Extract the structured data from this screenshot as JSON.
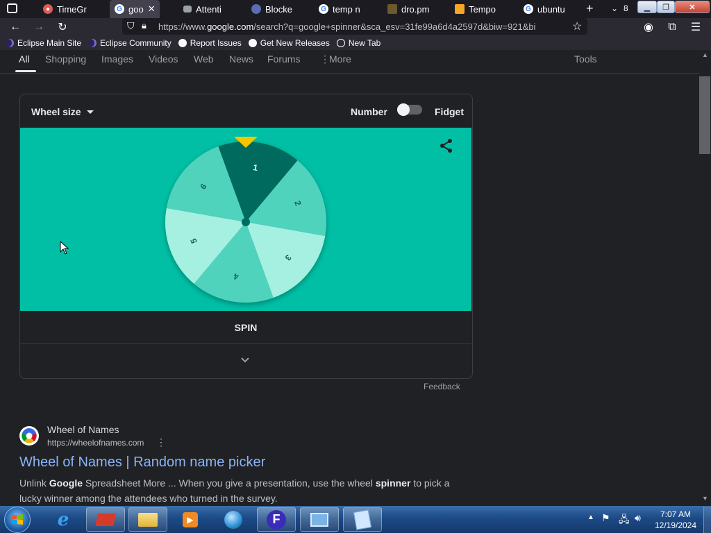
{
  "browser": {
    "tabs": [
      {
        "label": "TimeGr",
        "icon": "timegr-favicon"
      },
      {
        "label": "goo",
        "icon": "google-favicon",
        "active": true
      },
      {
        "label": "Attenti",
        "icon": "attention-favicon"
      },
      {
        "label": "Blocke",
        "icon": "blocked-favicon"
      },
      {
        "label": "temp n",
        "icon": "google-favicon"
      },
      {
        "label": "dro.pm",
        "icon": "dropm-favicon"
      },
      {
        "label": "Tempo",
        "icon": "tempo-favicon"
      },
      {
        "label": "ubuntu",
        "icon": "google-favicon"
      }
    ],
    "tab_count": "8",
    "url_prefix": "https://www.",
    "url_domain": "google.com",
    "url_rest": "/search?q=google+spinner&sca_esv=31fe99a6d4a2597d&biw=921&bi",
    "bookmarks": [
      {
        "label": "Eclipse Main Site",
        "icon": "eclipse-icon"
      },
      {
        "label": "Eclipse Community",
        "icon": "eclipse-icon"
      },
      {
        "label": "Report Issues",
        "icon": "github-icon"
      },
      {
        "label": "Get New Releases",
        "icon": "github-icon"
      },
      {
        "label": "New Tab",
        "icon": "globe-icon"
      }
    ]
  },
  "search_tabs": {
    "items": [
      "All",
      "Shopping",
      "Images",
      "Videos",
      "Web",
      "News",
      "Forums",
      "More"
    ],
    "tools": "Tools"
  },
  "spinner": {
    "wheel_size_label": "Wheel size",
    "mode_number": "Number",
    "mode_fidget": "Fidget",
    "toggle_on": false,
    "numbers": [
      "1",
      "2",
      "3",
      "4",
      "5",
      "6"
    ],
    "spin_label": "SPIN",
    "feedback": "Feedback",
    "colors": {
      "background": "#00bfa5",
      "dark": "#006b5f",
      "mid": "#4fd3bd",
      "light": "#a6f0e1",
      "pointer": "#f5c500"
    }
  },
  "result": {
    "site_name": "Wheel of Names",
    "site_url": "https://wheelofnames.com",
    "title": "Wheel of Names | Random name picker",
    "snippet_1": "Unlink ",
    "snippet_b1": "Google",
    "snippet_2": " Spreadsheet More ... When you give a presentation, use the wheel ",
    "snippet_b2": "spinner",
    "snippet_3": " to pick a",
    "snippet_line2": "lucky winner among the attendees who turned in the survey."
  },
  "taskbar": {
    "time": "7:07 AM",
    "date": "12/19/2024"
  }
}
